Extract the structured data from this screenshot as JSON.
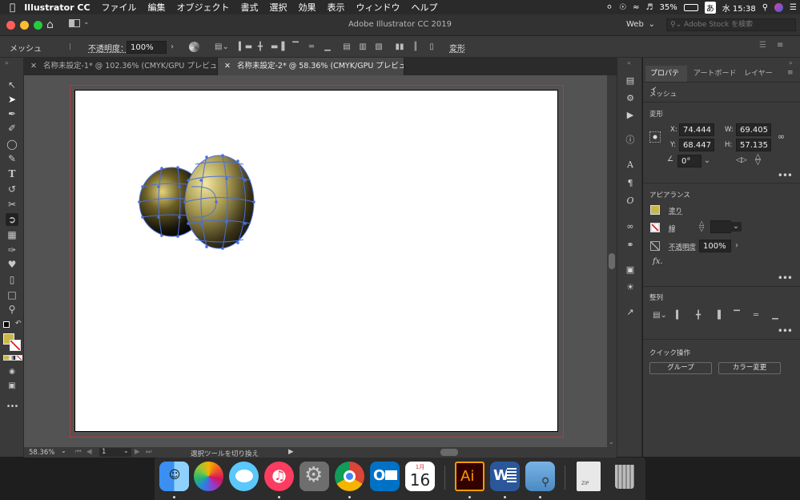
{
  "menubar": {
    "app_name": "Illustrator CC",
    "items": [
      "ファイル",
      "編集",
      "オブジェクト",
      "書式",
      "選択",
      "効果",
      "表示",
      "ウィンドウ",
      "ヘルプ"
    ],
    "battery": "35%",
    "ime": "あ",
    "clock": "水 15:38"
  },
  "appbar": {
    "title": "Adobe Illustrator CC 2019",
    "workspace": "Web",
    "stock_search_placeholder": "Adobe Stock を検索"
  },
  "control": {
    "selection_label": "メッシュ",
    "opacity_label": "不透明度：",
    "opacity_value": "100%",
    "transform_label": "変形"
  },
  "tabs": [
    {
      "label": "名称未設定-1* @ 102.36% (CMYK/GPU プレビュー)",
      "active": false
    },
    {
      "label": "名称未設定-2* @ 58.36% (CMYK/GPU プレビュー)",
      "active": true
    }
  ],
  "status": {
    "zoom": "58.36%",
    "artboard": "1",
    "tool_hint": "選択ツールを切り換え"
  },
  "panel": {
    "tabs": [
      "プロパティ",
      "アートボード",
      "レイヤー"
    ],
    "selection": "メッシュ",
    "transform": {
      "title": "変形",
      "x_label": "X:",
      "x": "74.444",
      "y_label": "Y:",
      "y": "68.447",
      "w_label": "W:",
      "w": "69.405",
      "h_label": "H:",
      "h": "57.135",
      "angle": "0°"
    },
    "appearance": {
      "title": "アピアランス",
      "fill_label": "塗り",
      "stroke_label": "線",
      "opacity_label": "不透明度",
      "opacity_value": "100%",
      "fx_label": "fx."
    },
    "align": {
      "title": "整列"
    },
    "quick": {
      "title": "クイック操作",
      "group_button": "グループ",
      "recolor_button": "カラー変更"
    }
  },
  "dock": {
    "calendar_month": "1月",
    "calendar_day": "16",
    "illustrator_label": "Ai",
    "outlook_label": "O",
    "word_label": "W",
    "zip_label": "ZIP"
  },
  "colors": {
    "fill_swatch": "#c8b84a",
    "mesh_line": "#4a6fe0",
    "artboard_border": "#c83232"
  }
}
